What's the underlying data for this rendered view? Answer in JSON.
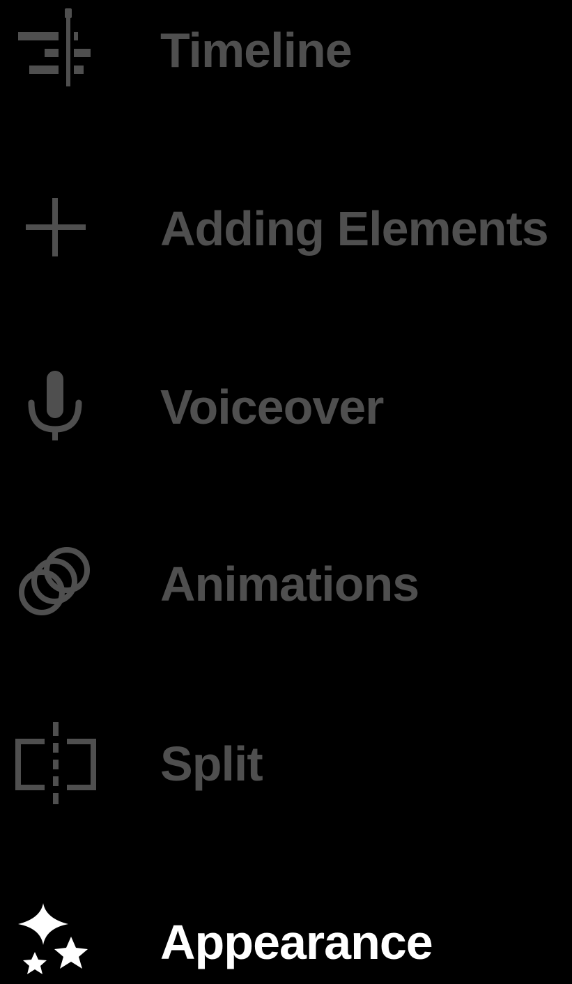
{
  "colors": {
    "background": "#000000",
    "inactive": "#4f4f4f",
    "active": "#ffffff"
  },
  "menu": {
    "items": [
      {
        "label": "Timeline",
        "icon": "timeline-icon",
        "active": false
      },
      {
        "label": "Adding Elements",
        "icon": "plus-icon",
        "active": false
      },
      {
        "label": "Voiceover",
        "icon": "microphone-icon",
        "active": false
      },
      {
        "label": "Animations",
        "icon": "animation-rings-icon",
        "active": false
      },
      {
        "label": "Split",
        "icon": "split-icon",
        "active": false
      },
      {
        "label": "Appearance",
        "icon": "sparkles-icon",
        "active": true
      }
    ]
  }
}
